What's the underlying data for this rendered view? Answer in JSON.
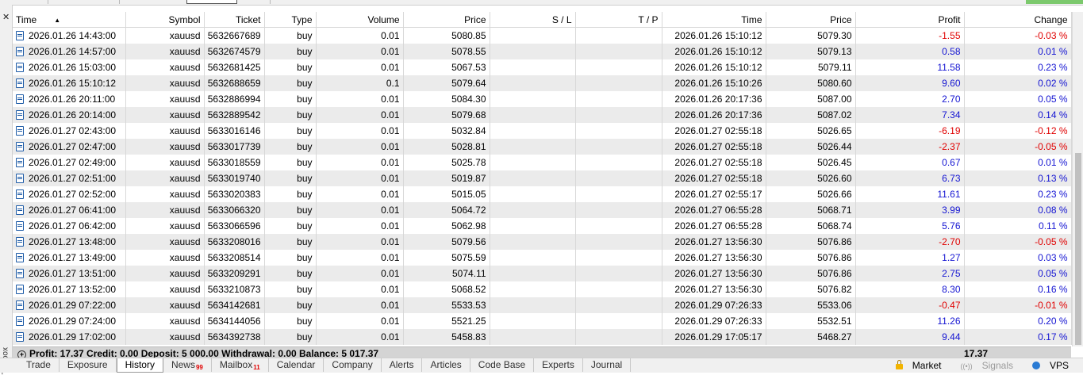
{
  "table": {
    "columns": {
      "time": "Time",
      "symbol": "Symbol",
      "ticket": "Ticket",
      "type": "Type",
      "volume": "Volume",
      "price": "Price",
      "sl": "S / L",
      "tp": "T / P",
      "time2": "Time",
      "price2": "Price",
      "profit": "Profit",
      "change": "Change"
    },
    "rows": [
      {
        "time": "2026.01.26 14:43:00",
        "symbol": "xauusd",
        "ticket": "5632667689",
        "type": "buy",
        "volume": "0.01",
        "price": "5080.85",
        "sl": "",
        "tp": "",
        "close_time": "2026.01.26 15:10:12",
        "close_price": "5079.30",
        "profit": "-1.55",
        "change": "-0.03 %"
      },
      {
        "time": "2026.01.26 14:57:00",
        "symbol": "xauusd",
        "ticket": "5632674579",
        "type": "buy",
        "volume": "0.01",
        "price": "5078.55",
        "sl": "",
        "tp": "",
        "close_time": "2026.01.26 15:10:12",
        "close_price": "5079.13",
        "profit": "0.58",
        "change": "0.01 %"
      },
      {
        "time": "2026.01.26 15:03:00",
        "symbol": "xauusd",
        "ticket": "5632681425",
        "type": "buy",
        "volume": "0.01",
        "price": "5067.53",
        "sl": "",
        "tp": "",
        "close_time": "2026.01.26 15:10:12",
        "close_price": "5079.11",
        "profit": "11.58",
        "change": "0.23 %"
      },
      {
        "time": "2026.01.26 15:10:12",
        "symbol": "xauusd",
        "ticket": "5632688659",
        "type": "buy",
        "volume": "0.1",
        "price": "5079.64",
        "sl": "",
        "tp": "",
        "close_time": "2026.01.26 15:10:26",
        "close_price": "5080.60",
        "profit": "9.60",
        "change": "0.02 %"
      },
      {
        "time": "2026.01.26 20:11:00",
        "symbol": "xauusd",
        "ticket": "5632886994",
        "type": "buy",
        "volume": "0.01",
        "price": "5084.30",
        "sl": "",
        "tp": "",
        "close_time": "2026.01.26 20:17:36",
        "close_price": "5087.00",
        "profit": "2.70",
        "change": "0.05 %"
      },
      {
        "time": "2026.01.26 20:14:00",
        "symbol": "xauusd",
        "ticket": "5632889542",
        "type": "buy",
        "volume": "0.01",
        "price": "5079.68",
        "sl": "",
        "tp": "",
        "close_time": "2026.01.26 20:17:36",
        "close_price": "5087.02",
        "profit": "7.34",
        "change": "0.14 %"
      },
      {
        "time": "2026.01.27 02:43:00",
        "symbol": "xauusd",
        "ticket": "5633016146",
        "type": "buy",
        "volume": "0.01",
        "price": "5032.84",
        "sl": "",
        "tp": "",
        "close_time": "2026.01.27 02:55:18",
        "close_price": "5026.65",
        "profit": "-6.19",
        "change": "-0.12 %"
      },
      {
        "time": "2026.01.27 02:47:00",
        "symbol": "xauusd",
        "ticket": "5633017739",
        "type": "buy",
        "volume": "0.01",
        "price": "5028.81",
        "sl": "",
        "tp": "",
        "close_time": "2026.01.27 02:55:18",
        "close_price": "5026.44",
        "profit": "-2.37",
        "change": "-0.05 %"
      },
      {
        "time": "2026.01.27 02:49:00",
        "symbol": "xauusd",
        "ticket": "5633018559",
        "type": "buy",
        "volume": "0.01",
        "price": "5025.78",
        "sl": "",
        "tp": "",
        "close_time": "2026.01.27 02:55:18",
        "close_price": "5026.45",
        "profit": "0.67",
        "change": "0.01 %"
      },
      {
        "time": "2026.01.27 02:51:00",
        "symbol": "xauusd",
        "ticket": "5633019740",
        "type": "buy",
        "volume": "0.01",
        "price": "5019.87",
        "sl": "",
        "tp": "",
        "close_time": "2026.01.27 02:55:18",
        "close_price": "5026.60",
        "profit": "6.73",
        "change": "0.13 %"
      },
      {
        "time": "2026.01.27 02:52:00",
        "symbol": "xauusd",
        "ticket": "5633020383",
        "type": "buy",
        "volume": "0.01",
        "price": "5015.05",
        "sl": "",
        "tp": "",
        "close_time": "2026.01.27 02:55:17",
        "close_price": "5026.66",
        "profit": "11.61",
        "change": "0.23 %"
      },
      {
        "time": "2026.01.27 06:41:00",
        "symbol": "xauusd",
        "ticket": "5633066320",
        "type": "buy",
        "volume": "0.01",
        "price": "5064.72",
        "sl": "",
        "tp": "",
        "close_time": "2026.01.27 06:55:28",
        "close_price": "5068.71",
        "profit": "3.99",
        "change": "0.08 %"
      },
      {
        "time": "2026.01.27 06:42:00",
        "symbol": "xauusd",
        "ticket": "5633066596",
        "type": "buy",
        "volume": "0.01",
        "price": "5062.98",
        "sl": "",
        "tp": "",
        "close_time": "2026.01.27 06:55:28",
        "close_price": "5068.74",
        "profit": "5.76",
        "change": "0.11 %"
      },
      {
        "time": "2026.01.27 13:48:00",
        "symbol": "xauusd",
        "ticket": "5633208016",
        "type": "buy",
        "volume": "0.01",
        "price": "5079.56",
        "sl": "",
        "tp": "",
        "close_time": "2026.01.27 13:56:30",
        "close_price": "5076.86",
        "profit": "-2.70",
        "change": "-0.05 %"
      },
      {
        "time": "2026.01.27 13:49:00",
        "symbol": "xauusd",
        "ticket": "5633208514",
        "type": "buy",
        "volume": "0.01",
        "price": "5075.59",
        "sl": "",
        "tp": "",
        "close_time": "2026.01.27 13:56:30",
        "close_price": "5076.86",
        "profit": "1.27",
        "change": "0.03 %"
      },
      {
        "time": "2026.01.27 13:51:00",
        "symbol": "xauusd",
        "ticket": "5633209291",
        "type": "buy",
        "volume": "0.01",
        "price": "5074.11",
        "sl": "",
        "tp": "",
        "close_time": "2026.01.27 13:56:30",
        "close_price": "5076.86",
        "profit": "2.75",
        "change": "0.05 %"
      },
      {
        "time": "2026.01.27 13:52:00",
        "symbol": "xauusd",
        "ticket": "5633210873",
        "type": "buy",
        "volume": "0.01",
        "price": "5068.52",
        "sl": "",
        "tp": "",
        "close_time": "2026.01.27 13:56:30",
        "close_price": "5076.82",
        "profit": "8.30",
        "change": "0.16 %"
      },
      {
        "time": "2026.01.29 07:22:00",
        "symbol": "xauusd",
        "ticket": "5634142681",
        "type": "buy",
        "volume": "0.01",
        "price": "5533.53",
        "sl": "",
        "tp": "",
        "close_time": "2026.01.29 07:26:33",
        "close_price": "5533.06",
        "profit": "-0.47",
        "change": "-0.01 %"
      },
      {
        "time": "2026.01.29 07:24:00",
        "symbol": "xauusd",
        "ticket": "5634144056",
        "type": "buy",
        "volume": "0.01",
        "price": "5521.25",
        "sl": "",
        "tp": "",
        "close_time": "2026.01.29 07:26:33",
        "close_price": "5532.51",
        "profit": "11.26",
        "change": "0.20 %"
      },
      {
        "time": "2026.01.29 17:02:00",
        "symbol": "xauusd",
        "ticket": "5634392738",
        "type": "buy",
        "volume": "0.01",
        "price": "5458.83",
        "sl": "",
        "tp": "",
        "close_time": "2026.01.29 17:05:17",
        "close_price": "5468.27",
        "profit": "9.44",
        "change": "0.17 %"
      }
    ]
  },
  "summary": {
    "text": "Profit: 17.37  Credit: 0.00  Deposit: 5 000.00  Withdrawal: 0.00  Balance: 5 017.37",
    "profit_total": "17.37"
  },
  "sidebar": {
    "label": "Toolbox"
  },
  "tabs": [
    {
      "label": "Trade",
      "badge": ""
    },
    {
      "label": "Exposure",
      "badge": ""
    },
    {
      "label": "History",
      "badge": "",
      "active": true
    },
    {
      "label": "News",
      "badge": "99"
    },
    {
      "label": "Mailbox",
      "badge": "11"
    },
    {
      "label": "Calendar",
      "badge": ""
    },
    {
      "label": "Company",
      "badge": ""
    },
    {
      "label": "Alerts",
      "badge": ""
    },
    {
      "label": "Articles",
      "badge": ""
    },
    {
      "label": "Code Base",
      "badge": ""
    },
    {
      "label": "Experts",
      "badge": ""
    },
    {
      "label": "Journal",
      "badge": ""
    }
  ],
  "status_right": {
    "market": "Market",
    "signals": "Signals",
    "vps": "VPS"
  },
  "colors": {
    "negative": "#e00000",
    "positive": "#1414d2"
  }
}
